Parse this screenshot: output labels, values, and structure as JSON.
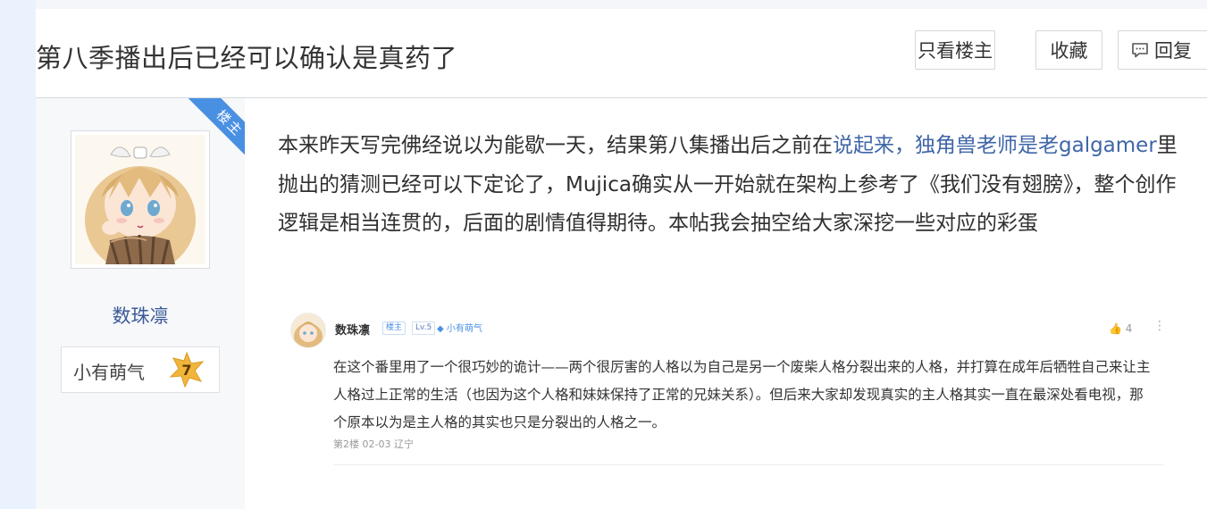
{
  "header": {
    "title": "第八季播出后已经可以确认是真药了",
    "buttons": {
      "only_op": "只看楼主",
      "favorite": "收藏",
      "reply": "回复"
    }
  },
  "author": {
    "op_ribbon": "楼主",
    "name": "数珠凛",
    "level_name": "小有萌气",
    "level": "7"
  },
  "post": {
    "text_before": "本来昨天写完佛经说以为能歇一天，结果第八集播出后之前在",
    "link_text": "说起来，独角兽老师是老galgamer",
    "text_after": "里抛出的猜测已经可以下定论了，Mujica确实从一开始就在架构上参考了《我们没有翅膀》，整个创作逻辑是相当连贯的，后面的剧情值得期待。本帖我会抽空给大家深挖一些对应的彩蛋"
  },
  "embedded_comment": {
    "username": "数珠凛",
    "op_tag": "楼主",
    "level_tag": "Lv.5",
    "badge": "小有萌气",
    "likes": "4",
    "body": "在这个番里用了一个很巧妙的诡计——两个很厉害的人格以为自己是另一个废柴人格分裂出来的人格，并打算在成年后牺牲自己来让主人格过上正常的生活（也因为这个人格和妹妹保持了正常的兄妹关系）。但后来大家却发现真实的主人格其实一直在最深处看电视，那个原本以为是主人格的其实也只是分裂出的人格之一。",
    "meta": "第2楼  02-03  辽宁"
  },
  "colors": {
    "link": "#3f66a7",
    "ribbon": "#4a90e2",
    "left_strip": "#e9f2fd",
    "author_bg": "#f7f8fa"
  }
}
